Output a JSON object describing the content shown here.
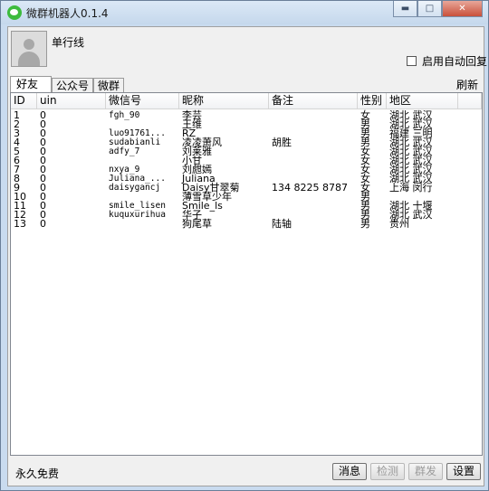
{
  "window": {
    "title": "微群机器人0.1.4"
  },
  "profile": {
    "username": "单行线"
  },
  "autoreply": {
    "label": "启用自动回复"
  },
  "tabs": [
    {
      "label": "好友"
    },
    {
      "label": "公众号"
    },
    {
      "label": "微群"
    }
  ],
  "refresh_label": "刷新",
  "table": {
    "columns": [
      "ID",
      "uin",
      "微信号",
      "昵称",
      "备注",
      "性别",
      "地区"
    ],
    "rows": [
      {
        "id": "1",
        "uin": "0",
        "wxid": "fgh_90",
        "nick": "李芸",
        "remark": "",
        "sex": "女",
        "region": "湖北 武汉"
      },
      {
        "id": "2",
        "uin": "0",
        "wxid": "",
        "nick": "王维",
        "remark": "",
        "sex": "男",
        "region": "湖北 武汉"
      },
      {
        "id": "3",
        "uin": "0",
        "wxid": "luo91761...",
        "nick": "RZ",
        "remark": "",
        "sex": "男",
        "region": "福建 三明"
      },
      {
        "id": "4",
        "uin": "0",
        "wxid": "sudabianli",
        "nick": "凌凌萧风",
        "remark": "胡胜",
        "sex": "男",
        "region": "湖北 武汉"
      },
      {
        "id": "5",
        "uin": "0",
        "wxid": "adfy_7",
        "nick": "刘莱雅",
        "remark": "",
        "sex": "女",
        "region": "湖北 武汉"
      },
      {
        "id": "6",
        "uin": "0",
        "wxid": "",
        "nick": "小甘",
        "remark": "",
        "sex": "女",
        "region": "湖北 武汉"
      },
      {
        "id": "7",
        "uin": "0",
        "wxid": "nxya_9",
        "nick": "刘甝嫣",
        "remark": "",
        "sex": "女",
        "region": "湖北 武汉"
      },
      {
        "id": "8",
        "uin": "0",
        "wxid": "Juliana_...",
        "nick": "Juliana",
        "remark": "",
        "sex": "女",
        "region": "湖北 武汉"
      },
      {
        "id": "9",
        "uin": "0",
        "wxid": "daisygancj",
        "nick": "Daisy甘翠菊",
        "remark": "134 8225 8787",
        "sex": "女",
        "region": "上海 闵行"
      },
      {
        "id": "10",
        "uin": "0",
        "wxid": "",
        "nick": "薄雪草少年",
        "remark": "",
        "sex": "男",
        "region": ""
      },
      {
        "id": "11",
        "uin": "0",
        "wxid": "smile_lisen",
        "nick": "Smile_ls",
        "remark": "",
        "sex": "男",
        "region": "湖北 十堰"
      },
      {
        "id": "12",
        "uin": "0",
        "wxid": "kuquxurihua",
        "nick": "华子",
        "remark": "",
        "sex": "男",
        "region": "湖北 武汉"
      },
      {
        "id": "13",
        "uin": "0",
        "wxid": "",
        "nick": "狗尾草",
        "remark": "陆轴",
        "sex": "男",
        "region": "贵州"
      }
    ]
  },
  "footer": {
    "text": "永久免费"
  },
  "buttons": {
    "message": "消息",
    "check": "检测",
    "broadcast": "群发",
    "settings": "设置"
  }
}
